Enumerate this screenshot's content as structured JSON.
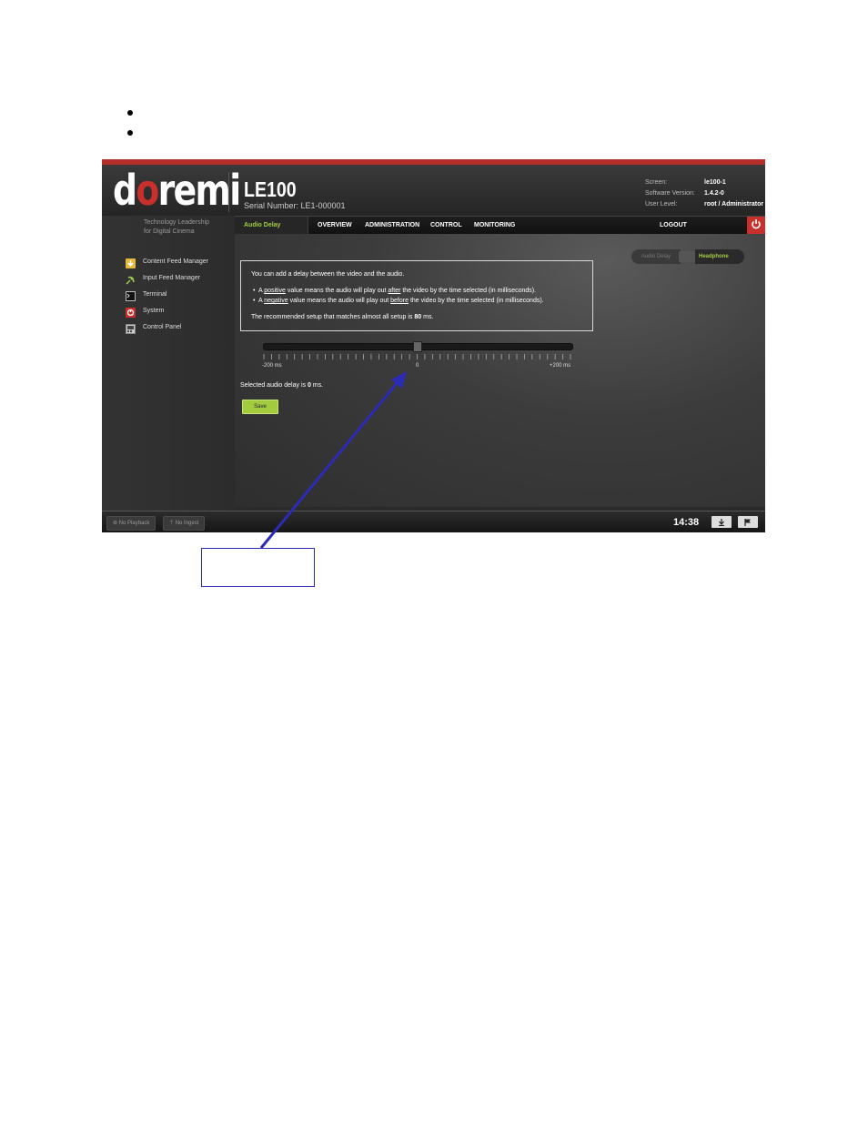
{
  "doc": {
    "bullets": [
      "",
      ""
    ]
  },
  "app": {
    "logo": {
      "pre": "d",
      "o": "o",
      "post": "remi"
    },
    "product": "LE100",
    "serial": "Serial Number: LE1-000001",
    "tagline": [
      "Technology Leadership",
      "for Digital Cinema"
    ],
    "meta": {
      "screen_label": "Screen:",
      "screen_value": "le100-1",
      "version_label": "Software Version:",
      "version_value": "1.4.2-0",
      "user_label": "User Level:",
      "user_value": "root / Administrator"
    },
    "colors": {
      "accent_red": "#c8302c",
      "accent_green": "#a2cb3e"
    }
  },
  "nav": {
    "active": "Audio Delay",
    "overview": "OVERVIEW",
    "administration": "ADMINISTRATION",
    "control": "CONTROL",
    "monitoring": "MONITORING",
    "logout": "LOGOUT",
    "power_icon": "power-icon"
  },
  "sidebar": {
    "items": [
      {
        "label": "Content Feed Manager",
        "icon": "download-icon"
      },
      {
        "label": "Input Feed Manager",
        "icon": "satellite-icon"
      },
      {
        "label": "Terminal",
        "icon": "terminal-icon"
      },
      {
        "label": "System",
        "icon": "system-icon"
      },
      {
        "label": "Control Panel",
        "icon": "control-panel-icon"
      }
    ]
  },
  "toggle": {
    "left": "Audio Delay",
    "right": "Headphone",
    "selected": "Headphone"
  },
  "info": {
    "intro": "You can add a delay between the video and the audio.",
    "b1_a": "A ",
    "b1_u1": "positive",
    "b1_b": " value means the audio will play out ",
    "b1_u2": "after",
    "b1_c": " the video by the time selected (in milliseconds).",
    "b2_a": "A ",
    "b2_u1": "negative",
    "b2_b": " value means the audio will play out ",
    "b2_u2": "before",
    "b2_c": " the video by the time selected (in milliseconds).",
    "reco_a": "The recommended setup that matches almost all setup is ",
    "reco_b": "80",
    "reco_c": " ms."
  },
  "slider": {
    "min_label": "-200 ms",
    "mid_label": "0",
    "max_label": "+200 ms",
    "min": -200,
    "max": 200,
    "value": 0
  },
  "selected": {
    "prefix": "Selected audio delay is ",
    "value": "0",
    "suffix": " ms."
  },
  "save_label": "Save",
  "footer": {
    "playback": "No Playback",
    "ingest": "No Ingest",
    "clock": "14:38",
    "icon_left": "download-icon",
    "icon_right": "flag-icon"
  }
}
